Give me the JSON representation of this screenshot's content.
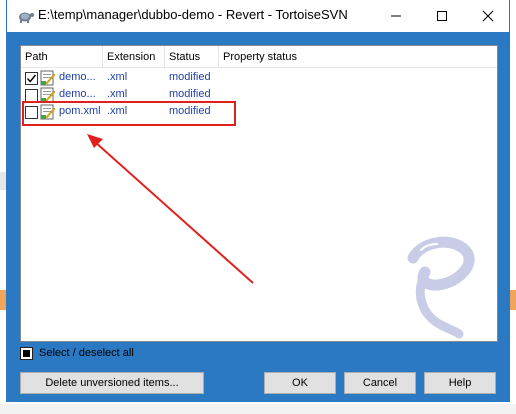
{
  "window": {
    "title": "E:\\temp\\manager\\dubbo-demo - Revert - TortoiseSVN",
    "app_icon": "tortoisesvn-icon",
    "controls": [
      "minimize-icon",
      "maximize-icon",
      "close-icon"
    ]
  },
  "list": {
    "columns": [
      "Path",
      "Extension",
      "Status",
      "Property status"
    ],
    "rows": [
      {
        "checked": true,
        "path": "demo...",
        "extension": ".xml",
        "status": "modified",
        "property_status": ""
      },
      {
        "checked": false,
        "path": "demo...",
        "extension": ".xml",
        "status": "modified",
        "property_status": ""
      },
      {
        "checked": false,
        "path": "pom.xml",
        "extension": ".xml",
        "status": "modified",
        "property_status": ""
      }
    ]
  },
  "footer": {
    "select_all_label": "Select / deselect all",
    "select_all_state": "indeterminate",
    "buttons": {
      "delete_unversioned": "Delete unversioned items...",
      "ok": "OK",
      "cancel": "Cancel",
      "help": "Help"
    }
  },
  "annotation": {
    "color": "#e0201c"
  },
  "colors": {
    "accent": "#2b79c2",
    "link_text": "#1f3fa8"
  }
}
